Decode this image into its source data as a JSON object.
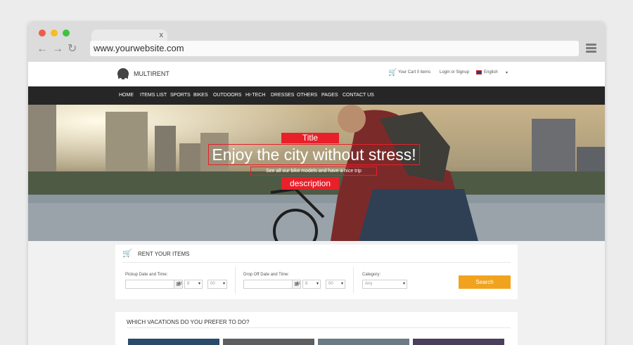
{
  "browser": {
    "url": "www.yourwebsite.com",
    "tab_close": "x"
  },
  "site": {
    "brand": "MULTIRENT",
    "cart": "Your Cart 0 items",
    "login": "Login or Signup",
    "language": "English",
    "menu": [
      "HOME",
      "ITEMS LIST",
      "SPORTS",
      "BIKES",
      "OUTDOORS",
      "HI-TECH",
      "DRESSES",
      "OTHERS",
      "PAGES",
      "CONTACT US"
    ],
    "hero": {
      "title_tag": "Title",
      "title": "Enjoy the city without stress!",
      "description": "See all our bike models and have a nice trip",
      "description_tag": "description"
    },
    "rent": {
      "heading": "RENT YOUR ITEMS",
      "pickup_label": "Pickup Date and Time:",
      "dropoff_label": "Drop Off Date and Time:",
      "at": "At",
      "hour": "8",
      "minute": "00",
      "category_label": "Category:",
      "category_value": "Any",
      "search": "Search"
    },
    "vacations": {
      "heading": "WHICH VACATIONS DO YOU PREFER TO DO?"
    }
  },
  "colors": {
    "accent_red": "#e8202a",
    "search_orange": "#f2a31e",
    "menu_bg": "#262626"
  },
  "icons": [
    "back-arrow-icon",
    "forward-arrow-icon",
    "reload-icon",
    "hamburger-menu-icon",
    "cart-icon",
    "calendar-icon",
    "chevron-down-icon"
  ]
}
